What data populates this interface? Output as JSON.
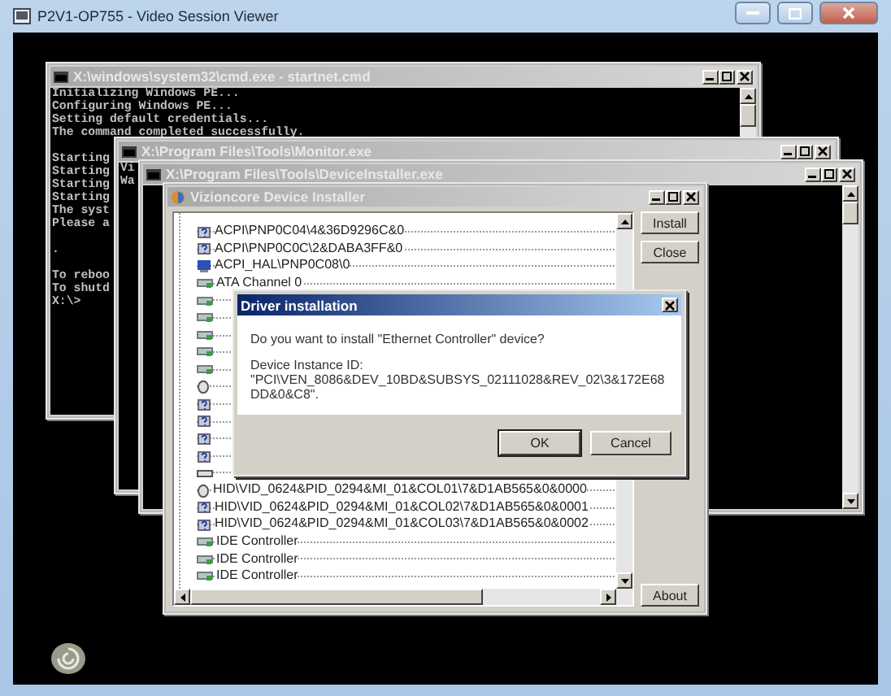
{
  "viewer": {
    "title": "P2V1-OP755 - Video Session Viewer"
  },
  "windows": [
    {
      "kind": "console",
      "title": "X:\\windows\\system32\\cmd.exe - startnet.cmd",
      "active": false,
      "blocks": [
        [
          "Initializing Windows PE...",
          "Configuring Windows PE...",
          "Setting default credentials...",
          "The command completed successfully."
        ],
        [
          "Starting",
          "Starting",
          "Starting",
          "Starting",
          "The syst",
          "Please a"
        ],
        [
          "."
        ],
        [
          "To reboo",
          "To shutd",
          "X:\\>"
        ]
      ]
    },
    {
      "kind": "console",
      "title": "X:\\Program Files\\Tools\\Monitor.exe",
      "active": false,
      "blocks": [
        [
          "Vi",
          "Wa"
        ]
      ]
    },
    {
      "kind": "console",
      "title": "X:\\Program Files\\Tools\\DeviceInstaller.exe",
      "active": false
    }
  ],
  "installer": {
    "title": "Vizioncore Device Installer",
    "active": false,
    "tree": [
      {
        "kind": "unknown",
        "label": "ACPI\\PNP0C04\\4&36D9296C&0"
      },
      {
        "kind": "unknown",
        "label": "ACPI\\PNP0C0C\\2&DABA3FF&0"
      },
      {
        "kind": "computer",
        "label": "ACPI_HAL\\PNP0C08\\0"
      },
      {
        "kind": "controller",
        "label": "ATA Channel 0"
      },
      {
        "kind": "controller"
      },
      {
        "kind": "controller"
      },
      {
        "kind": "controller"
      },
      {
        "kind": "controller"
      },
      {
        "kind": "controller"
      },
      {
        "kind": "mouse"
      },
      {
        "kind": "unknown"
      },
      {
        "kind": "unknown"
      },
      {
        "kind": "unknown"
      },
      {
        "kind": "unknown"
      },
      {
        "kind": "keyboard"
      },
      {
        "kind": "mouse",
        "label": "HID\\VID_0624&PID_0294&MI_01&COL01\\7&D1AB565&0&0000"
      },
      {
        "kind": "unknown",
        "label": "HID\\VID_0624&PID_0294&MI_01&COL02\\7&D1AB565&0&0001"
      },
      {
        "kind": "unknown",
        "label": "HID\\VID_0624&PID_0294&MI_01&COL03\\7&D1AB565&0&0002"
      },
      {
        "kind": "controller",
        "label": "IDE Controller"
      },
      {
        "kind": "controller",
        "label": "IDE Controller"
      },
      {
        "kind": "controller",
        "label": "IDE Controller"
      }
    ],
    "buttons": [
      {
        "label": "Install"
      },
      {
        "label": "Close"
      }
    ],
    "footer_button": {
      "label": "About"
    }
  },
  "dialog": {
    "title": "Driver installation",
    "active": true,
    "question": "Do you want to install \"Ethernet Controller\" device?",
    "id_label": "Device Instance ID:",
    "id_value": "\"PCI\\VEN_8086&DEV_10BD&SUBSYS_02111028&REV_02\\3&172E68DD&0&C8\".",
    "buttons": [
      {
        "label": "OK",
        "selected": true
      },
      {
        "label": "Cancel",
        "selected": false
      }
    ]
  }
}
